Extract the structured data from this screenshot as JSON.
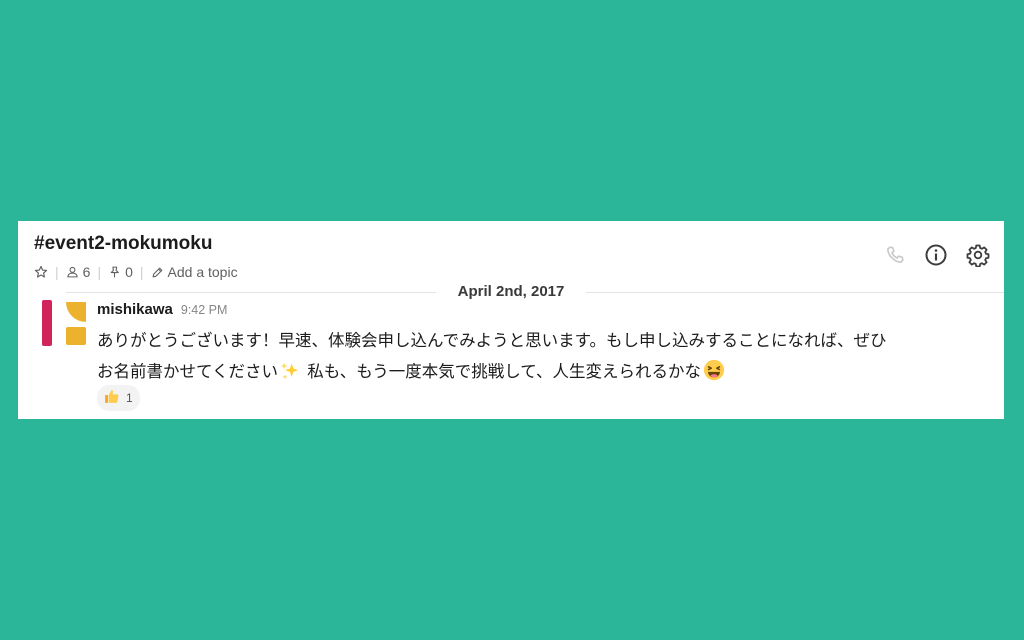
{
  "channel": {
    "name": "#event2-mokumoku",
    "members_count": "6",
    "pinned_count": "0",
    "add_topic_label": "Add a topic"
  },
  "header_actions": {
    "call_icon": "phone-icon",
    "info_icon": "info-icon",
    "settings_icon": "gear-icon"
  },
  "date_divider": "April 2nd, 2017",
  "message": {
    "author": "mishikawa",
    "time": "9:42 PM",
    "line1": "ありがとうございます！早速、体験会申し込んでみようと思います。もし申し込みすることになれば、ぜひ",
    "line2_before_emoji": "お名前書かせてください",
    "line2_after_sparkles": " 私も、もう一度本気で挑戦して、人生変えられるかな",
    "emojis": [
      "sparkles-emoji",
      "laughing-emoji"
    ]
  },
  "reaction": {
    "emoji": "thumbs-up-emoji",
    "count": "1"
  },
  "colors": {
    "background": "#2bb599",
    "panel": "#ffffff",
    "avatar_red": "#d0245b",
    "avatar_yellow": "#ecb22e"
  }
}
